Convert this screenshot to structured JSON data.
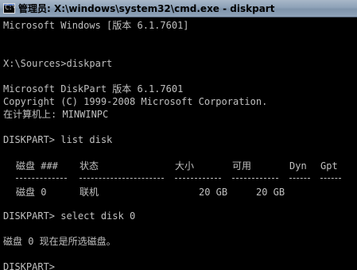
{
  "window": {
    "title": "管理员: X:\\windows\\system32\\cmd.exe - diskpart",
    "icon": "cmd-icon",
    "icon_glyph": "C:\\",
    "colors": {
      "background": "#000000",
      "text": "#c0c0c0"
    }
  },
  "console": {
    "lines": [
      "Microsoft Windows [版本 6.1.7601]",
      "X:\\Sources>diskpart",
      "Microsoft DiskPart 版本 6.1.7601",
      "Copyright (C) 1999-2008 Microsoft Corporation.",
      "在计算机上: MINWINPC",
      "DISKPART> list disk",
      "DISKPART> select disk 0",
      "磁盘 0 现在是所选磁盘。",
      "DISKPART>"
    ],
    "disk_table": {
      "headers": [
        "磁盘 ###",
        "状态",
        "大小",
        "可用",
        "Dyn",
        "Gpt"
      ],
      "rows": [
        [
          "磁盘 0",
          "联机",
          "20 GB",
          "20 GB",
          "",
          ""
        ]
      ]
    }
  }
}
